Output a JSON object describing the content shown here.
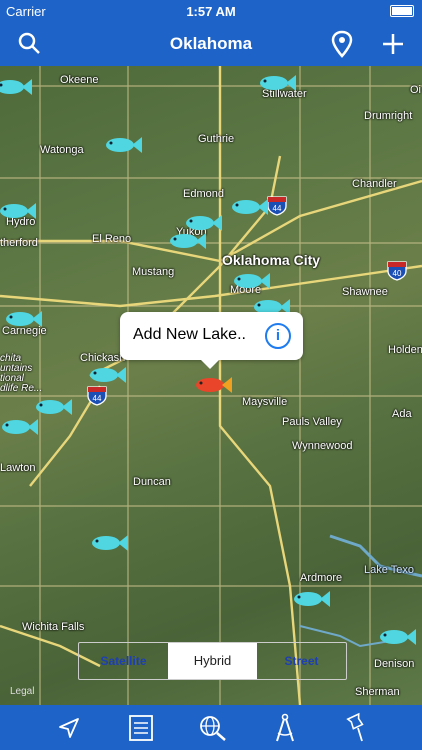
{
  "status": {
    "carrier": "Carrier",
    "time": "1:57 AM"
  },
  "nav": {
    "title": "Oklahoma",
    "search_icon": "search-icon",
    "pin_icon": "location-pin-icon",
    "add_icon": "plus-icon"
  },
  "map": {
    "labels": {
      "okeene": "Okeene",
      "stillwater": "Stillwater",
      "watonga": "Watonga",
      "guthrie": "Guthrie",
      "edmond": "Edmond",
      "chandler": "Chandler",
      "hydro": "Hydro",
      "el_reno": "El Reno",
      "yukon": "Yukon",
      "weatherford": "therford",
      "okc": "Oklahoma City",
      "mustang": "Mustang",
      "moore": "Moore",
      "shawnee": "Shawnee",
      "carnegie": "Carnegie",
      "chickasha": "Chickash",
      "holdenville": "Holden",
      "maysville": "Maysville",
      "pauls_valley": "Pauls Valley",
      "ada": "Ada",
      "wynnewood": "Wynnewood",
      "lawton": "Lawton",
      "duncan": "Duncan",
      "ardmore": "Ardmore",
      "lake_texoma": "Lake Texo",
      "wichita_falls": "Wichita Falls",
      "denison": "Denison",
      "sherman": "Sherman",
      "drumright": "Drumright",
      "oi": "Oi",
      "wichita_mtns": "chita\nuntains\ntional\ndlife Re..."
    },
    "shields": {
      "i44a": "44",
      "i40": "40",
      "i44b": "44"
    },
    "legal": "Legal"
  },
  "popup": {
    "text": "Add New Lake..",
    "info": "i"
  },
  "segments": {
    "satellite": "Satellite",
    "hybrid": "Hybrid",
    "street": "Street",
    "selected": "Hybrid"
  },
  "tabbar": {
    "items": [
      "navigate-arrow-icon",
      "list-icon",
      "globe-search-icon",
      "compass-draw-icon",
      "pushpin-icon"
    ]
  },
  "colors": {
    "bar": "#1e63c7",
    "fish_cyan": "#4fd6e0",
    "fish_red": "#e8452a"
  }
}
